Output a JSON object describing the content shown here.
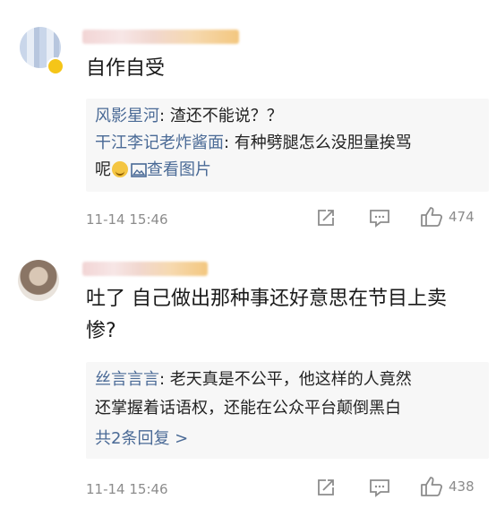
{
  "comments": [
    {
      "text": "自作自受",
      "replies": [
        {
          "name": "风影星河",
          "text": "渣还不能说？？"
        },
        {
          "name": "干江李记老炸酱面",
          "text_line1": "有种劈腿怎么没胆量挨骂",
          "text_line2": "呢",
          "link": "查看图片"
        }
      ],
      "time": "11-14 15:46",
      "likes": "474"
    },
    {
      "text_line1": "吐了 自己做出那种事还好意思在节目上卖",
      "text_line2": "惨?",
      "replies": [
        {
          "name": "丝言言言",
          "text_line1": "老天真是不公平，他这样的人竟然",
          "text_line2": "还掌握着话语权，还能在公众平台颠倒黑白"
        }
      ],
      "more_replies": "共2条回复 >",
      "time": "11-14 15:46",
      "likes": "438"
    }
  ]
}
